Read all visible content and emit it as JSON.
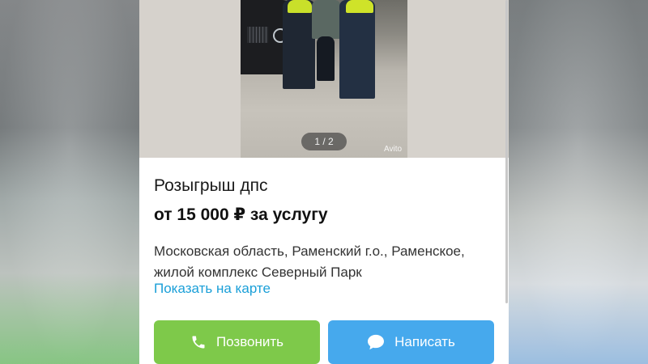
{
  "gallery": {
    "counter": "1 / 2",
    "watermark": "Avito"
  },
  "listing": {
    "title": "Розыгрыш дпс",
    "price": "от 15 000 ₽ за услугу",
    "address_line1": "Московская область, Раменский г.о., Раменское,",
    "address_line2": "жилой комплекс Северный Парк",
    "map_link": "Показать на карте"
  },
  "actions": {
    "call_label": "Позвонить",
    "call_icon": "phone-icon",
    "message_label": "Написать",
    "message_icon": "chat-bubble-icon"
  },
  "colors": {
    "call_button": "#7ec94a",
    "message_button": "#46a9ed",
    "link": "#1a9fd8"
  }
}
